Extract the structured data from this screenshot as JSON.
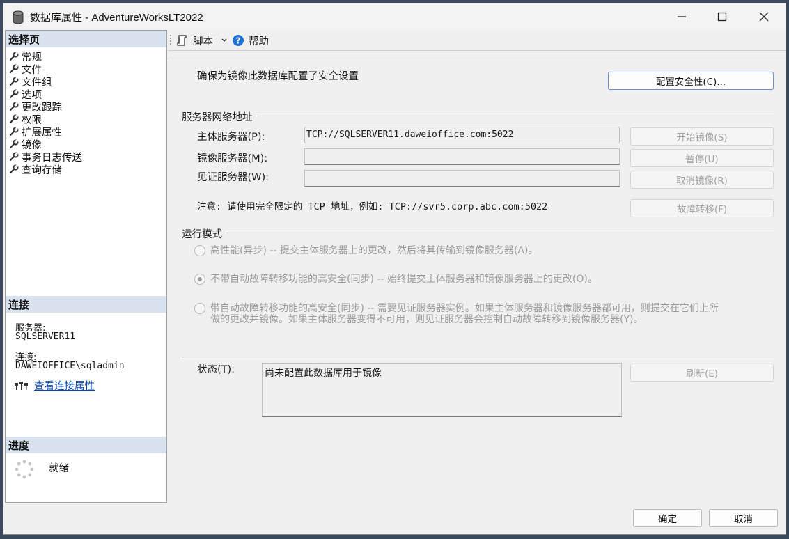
{
  "window": {
    "title": "数据库属性 - AdventureWorksLT2022",
    "icon": "database-icon"
  },
  "left": {
    "select_page_header": "选择页",
    "pages": [
      {
        "label": "常规"
      },
      {
        "label": "文件"
      },
      {
        "label": "文件组"
      },
      {
        "label": "选项"
      },
      {
        "label": "更改跟踪"
      },
      {
        "label": "权限"
      },
      {
        "label": "扩展属性"
      },
      {
        "label": "镜像"
      },
      {
        "label": "事务日志传送"
      },
      {
        "label": "查询存储"
      }
    ],
    "connection_header": "连接",
    "server_label": "服务器:",
    "server_value": "SQLSERVER11",
    "connection_label": "连接:",
    "connection_value": "DAWEIOFFICE\\sqladmin",
    "view_connection_link": "查看连接属性",
    "progress_header": "进度",
    "progress_status": "就绪"
  },
  "toolbar": {
    "script_label": "脚本",
    "help_label": "帮助"
  },
  "main": {
    "security_note": "确保为镜像此数据库配置了安全设置",
    "configure_security_button": "配置安全性(C)...",
    "network_group_title": "服务器网络地址",
    "principal_label": "主体服务器(P):",
    "principal_value": "TCP://SQLSERVER11.daweioffice.com:5022",
    "mirror_label": "镜像服务器(M):",
    "mirror_value": "",
    "witness_label": "见证服务器(W):",
    "witness_value": "",
    "start_mirroring_button": "开始镜像(S)",
    "pause_button": "暂停(U)",
    "remove_mirroring_button": "取消镜像(R)",
    "failover_button": "故障转移(F)",
    "note": "注意: 请使用完全限定的 TCP 地址，例如: TCP://svr5.corp.abc.com:5022",
    "operating_mode_title": "运行模式",
    "mode_high_performance": "高性能(异步) -- 提交主体服务器上的更改，然后将其传输到镜像服务器(A)。",
    "mode_high_safety_no_failover": "不带自动故障转移功能的高安全(同步) -- 始终提交主体服务器和镜像服务器上的更改(O)。",
    "mode_high_safety_failover_line1": "带自动故障转移功能的高安全(同步) -- 需要见证服务器实例。如果主体服务器和镜像服务器都可用，则提交在它们上所",
    "mode_high_safety_failover_line2": "做的更改并镜像。如果主体服务器变得不可用，则见证服务器会控制自动故障转移到镜像服务器(Y)。",
    "selected_mode": "high-safety-no-failover",
    "status_label": "状态(T):",
    "status_value": "尚未配置此数据库用于镜像",
    "refresh_button": "刷新(E)"
  },
  "footer": {
    "ok_button": "确定",
    "cancel_button": "取消"
  }
}
